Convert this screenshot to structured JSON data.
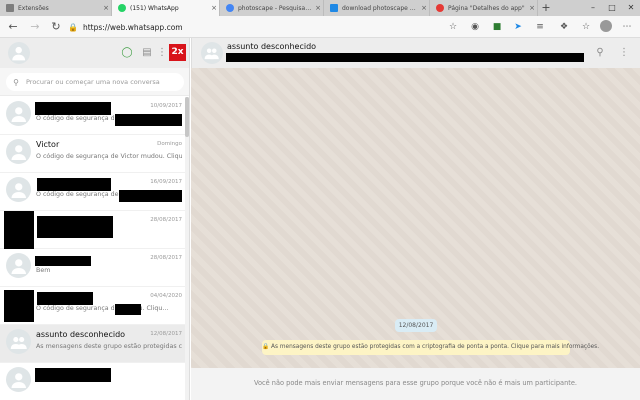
{
  "browser": {
    "tabs": [
      {
        "label": "Extensões",
        "close": "×"
      },
      {
        "label": "(151) WhatsApp",
        "close": "×",
        "active": true
      },
      {
        "label": "photoscape - Pesquisa Google",
        "close": "×"
      },
      {
        "label": "download photoscape grátis",
        "close": "×"
      },
      {
        "label": "Página \"Detalhes do app\"",
        "close": "×"
      }
    ],
    "new_tab": "+",
    "window_controls": {
      "minimize": "–",
      "maximize": "□",
      "close": "✕"
    },
    "url": "https://web.whatsapp.com",
    "colors": {
      "whatsapp_favicon": "#25d366",
      "google_favicon": "#4285f4",
      "download_favicon": "#1e88e5",
      "webstore_favicon": "#e53935"
    }
  },
  "left_panel": {
    "badge": "2x",
    "search": {
      "placeholder": "Procurar ou começar uma nova conversa"
    },
    "chats": [
      {
        "name": "",
        "date": "10/09/2017",
        "preview": "O código de segurança de"
      },
      {
        "name": "Victor",
        "date": "Domingo",
        "preview": "O código de segurança de Victor mudou. Cliqu..."
      },
      {
        "name": "",
        "date": "16/09/2017",
        "preview": "O código de segurança de"
      },
      {
        "name": "",
        "date": "28/08/2017",
        "preview": ""
      },
      {
        "name": "",
        "date": "28/08/2017",
        "preview": "Bem"
      },
      {
        "name": "",
        "date": "04/04/2020",
        "preview": "O código de segurança de                 mudou. Cliqu..."
      },
      {
        "name": "assunto desconhecido",
        "date": "12/08/2017",
        "preview": "As mensagens deste grupo estão protegidas co...",
        "selected": true
      },
      {
        "name": "",
        "date": "",
        "preview": ""
      }
    ]
  },
  "conversation": {
    "title": "assunto desconhecido",
    "date_pill": "12/08/2017",
    "system_message": "🔒 As mensagens deste grupo estão protegidas com a criptografia de ponta a ponta. Clique para mais informações.",
    "footer": "Você não pode mais enviar mensagens para esse grupo porque você não é mais um participante."
  },
  "icons": {
    "back": "arrow-left-icon",
    "forward": "arrow-right-icon",
    "refresh": "refresh-icon",
    "lock": "lock-icon",
    "star": "star-icon",
    "status": "status-icon",
    "new_chat": "chat-icon",
    "menu": "menu-icon",
    "search": "search-icon",
    "default_avatar": "person-icon",
    "group_avatar": "group-icon"
  }
}
